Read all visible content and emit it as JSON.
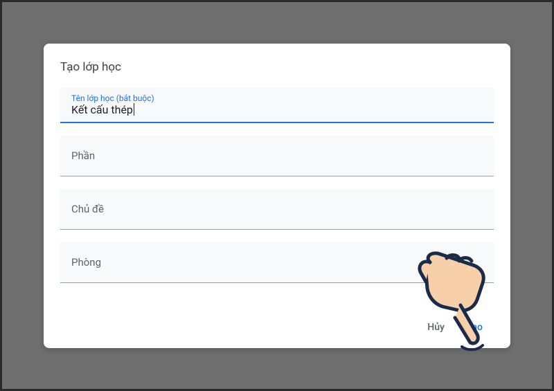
{
  "dialog": {
    "title": "Tạo lớp học",
    "fields": {
      "class_name": {
        "label": "Tên lớp học (bắt buộc)",
        "value": "Kết cấu thép"
      },
      "section": {
        "placeholder": "Phần"
      },
      "subject": {
        "placeholder": "Chủ đề"
      },
      "room": {
        "placeholder": "Phòng"
      }
    },
    "actions": {
      "cancel": "Hủy",
      "create": "Tạo"
    }
  },
  "colors": {
    "accent": "#1a73e8",
    "text_primary": "#202124",
    "text_secondary": "#5f6368",
    "field_bg": "#f8f9fa"
  }
}
